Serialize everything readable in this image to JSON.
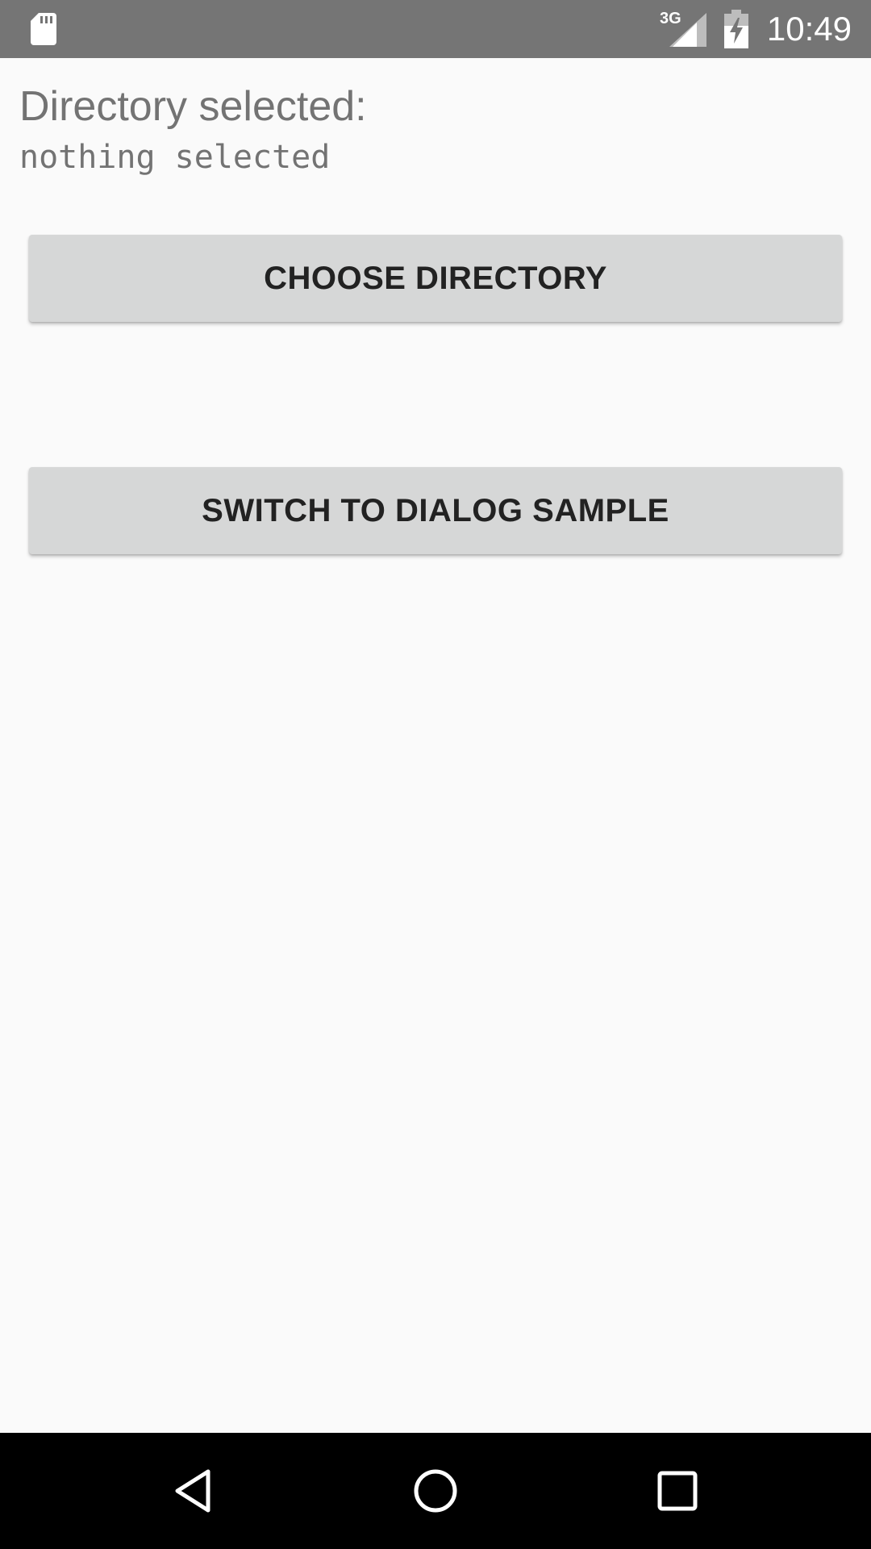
{
  "status_bar": {
    "network_type": "3G",
    "time": "10:49",
    "icons": [
      "sd-card-icon",
      "cell-signal-icon",
      "battery-charging-icon"
    ]
  },
  "main": {
    "directory_label": "Directory selected:",
    "directory_value": "nothing selected",
    "choose_button_label": "CHOOSE DIRECTORY",
    "switch_button_label": "SWITCH TO DIALOG SAMPLE"
  },
  "nav_bar": {
    "icons": [
      "back-icon",
      "home-icon",
      "recents-icon"
    ]
  },
  "colors": {
    "status_bar_bg": "#757575",
    "background": "#fafafa",
    "button_bg": "#d6d7d7",
    "text_secondary": "#737373",
    "button_text": "#222222",
    "nav_bar_bg": "#000000"
  }
}
